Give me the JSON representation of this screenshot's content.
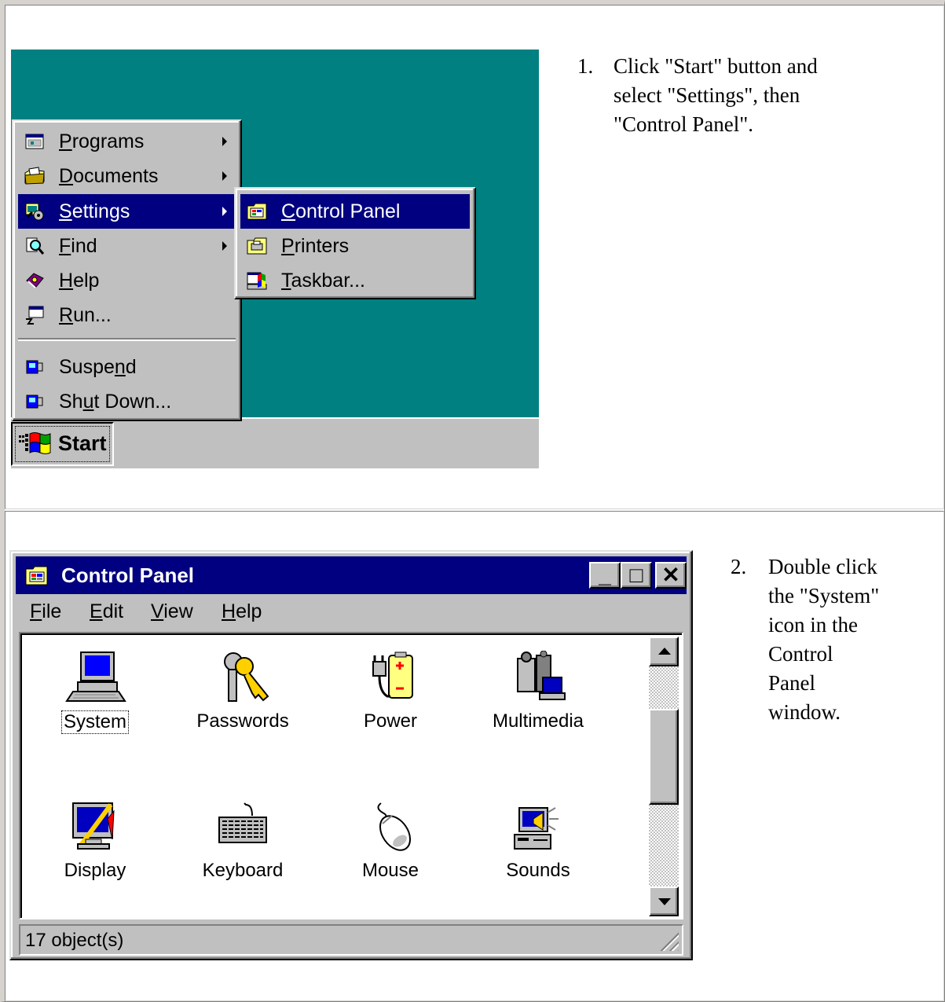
{
  "step1": {
    "number": "1.",
    "lines": [
      "Click \"Start\" button and",
      "select \"Settings\", then",
      "\"Control Panel\"."
    ]
  },
  "step2": {
    "number": "2.",
    "lines": [
      "Double click",
      "the \"System\"",
      "icon in the",
      "Control",
      "Panel",
      "window."
    ]
  },
  "start_menu": {
    "items": [
      {
        "pre": "",
        "u": "P",
        "post": "rograms",
        "icon": "programs-icon",
        "submenu": true
      },
      {
        "pre": "",
        "u": "D",
        "post": "ocuments",
        "icon": "documents-icon",
        "submenu": true
      },
      {
        "pre": "",
        "u": "S",
        "post": "ettings",
        "icon": "settings-icon",
        "submenu": true,
        "selected": true
      },
      {
        "pre": "",
        "u": "F",
        "post": "ind",
        "icon": "find-icon",
        "submenu": true
      },
      {
        "pre": "",
        "u": "H",
        "post": "elp",
        "icon": "help-icon",
        "submenu": false
      },
      {
        "pre": "",
        "u": "R",
        "post": "un...",
        "icon": "run-icon",
        "submenu": false
      },
      {
        "pre": "Suspe",
        "u": "n",
        "post": "d",
        "icon": "suspend-icon",
        "submenu": false
      },
      {
        "pre": "Sh",
        "u": "u",
        "post": "t Down...",
        "icon": "shutdown-icon",
        "submenu": false
      }
    ],
    "start_label": "Start"
  },
  "settings_submenu": {
    "items": [
      {
        "pre": "",
        "u": "C",
        "post": "ontrol Panel",
        "icon": "control-panel-icon",
        "selected": true
      },
      {
        "pre": "",
        "u": "P",
        "post": "rinters",
        "icon": "printers-icon"
      },
      {
        "pre": "",
        "u": "T",
        "post": "askbar...",
        "icon": "taskbar-icon"
      }
    ]
  },
  "control_panel": {
    "title": "Control Panel",
    "menus": [
      {
        "u": "F",
        "post": "ile"
      },
      {
        "u": "E",
        "post": "dit"
      },
      {
        "u": "V",
        "post": "iew"
      },
      {
        "u": "H",
        "post": "elp"
      }
    ],
    "icons": [
      {
        "label": "System",
        "icon": "system-icon",
        "focused": true
      },
      {
        "label": "Passwords",
        "icon": "passwords-icon"
      },
      {
        "label": "Power",
        "icon": "power-icon"
      },
      {
        "label": "Multimedia",
        "icon": "multimedia-icon"
      },
      {
        "label": "Display",
        "icon": "display-icon"
      },
      {
        "label": "Keyboard",
        "icon": "keyboard-icon"
      },
      {
        "label": "Mouse",
        "icon": "mouse-icon"
      },
      {
        "label": "Sounds",
        "icon": "sounds-icon"
      }
    ],
    "status": "17 object(s)",
    "buttons": {
      "minimize": "_",
      "maximize": "□",
      "close": "✕"
    }
  },
  "colors": {
    "desktop": "#008080",
    "titlebar": "#000080",
    "face": "#c0c0c0",
    "selection": "#000080"
  }
}
